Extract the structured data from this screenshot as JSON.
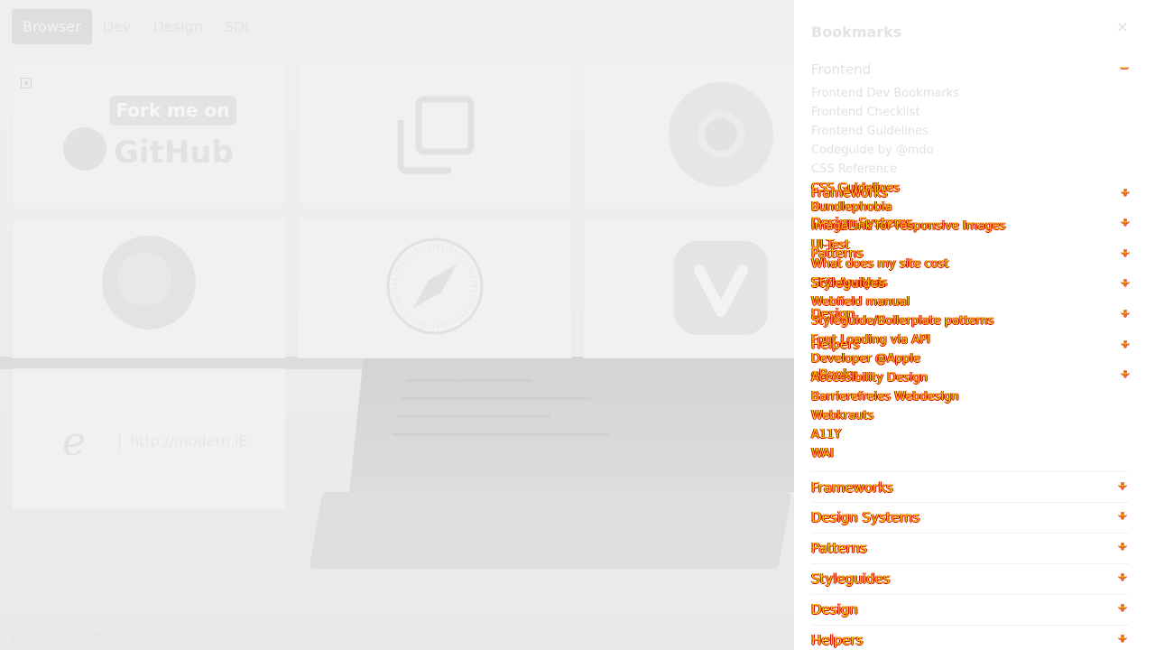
{
  "tabs": [
    "Browser",
    "Dev",
    "Design",
    "SDI"
  ],
  "tiles": {
    "github_banner": "Fork me on",
    "github_word": "GitHub",
    "modern_ie": "http://modern.IE"
  },
  "footer_link": "Fork me on GitHub",
  "sidebar": {
    "title": "Bookmarks",
    "close": "×",
    "open_section": {
      "label": "Frontend",
      "toggle": "−"
    },
    "frontend_links": [
      "Frontend Dev Bookmarks",
      "Frontend Checklist",
      "Frontend Guidelines",
      "Codeguide by @mdo",
      "CSS Reference",
      "CSS Guidelines",
      "Bundlephobia",
      "ImageLink for responsive Images",
      "UI-Test",
      "What does my site cost",
      "SEO Analysis",
      "Webfield manual",
      "Styleguide/Boilerplate patterns",
      "Font Loading via API",
      "Developer @Apple",
      "Accessibility Design",
      "Barrierefreies Webdesign",
      "Webkrauts",
      "A11Y",
      "WAI"
    ],
    "overlay_heads": [
      "Frameworks",
      "Design Systems",
      "Patterns",
      "Styleguides",
      "Design",
      "Helpers",
      "eBooks"
    ],
    "sections": [
      {
        "label": "Frameworks",
        "toggle": "+"
      },
      {
        "label": "Design Systems",
        "toggle": "+"
      },
      {
        "label": "Patterns",
        "toggle": "+"
      },
      {
        "label": "Styleguides",
        "toggle": "+"
      },
      {
        "label": "Design",
        "toggle": "+"
      },
      {
        "label": "Helpers",
        "toggle": "+"
      }
    ]
  }
}
